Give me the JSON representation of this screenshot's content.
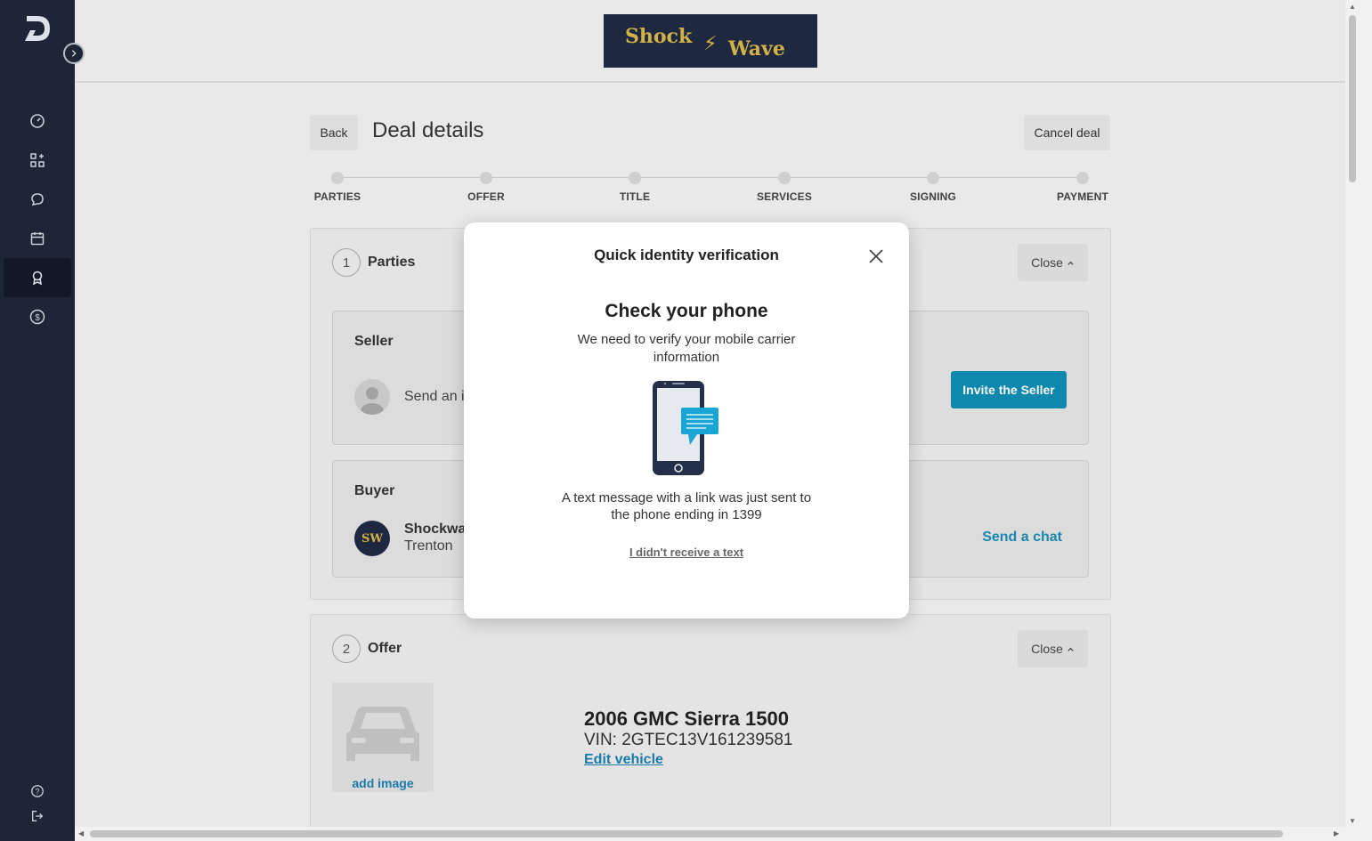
{
  "brand": {
    "logo_line1": "Shock",
    "logo_line2": "Wave",
    "bolt": "⚡"
  },
  "header": {
    "back_label": "Back",
    "title": "Deal details",
    "cancel_label": "Cancel deal"
  },
  "steps": [
    {
      "label": "PARTIES"
    },
    {
      "label": "OFFER"
    },
    {
      "label": "TITLE"
    },
    {
      "label": "SERVICES"
    },
    {
      "label": "SIGNING"
    },
    {
      "label": "PAYMENT"
    }
  ],
  "parties": {
    "number": "1",
    "title": "Parties",
    "close_label": "Close",
    "seller": {
      "title": "Seller",
      "text": "Send an in",
      "invite_label": "Invite the Seller"
    },
    "buyer": {
      "title": "Buyer",
      "name": "Shockway",
      "city": "Trenton",
      "chat_label": "Send a chat",
      "avatar_text": "SW"
    }
  },
  "offer": {
    "number": "2",
    "title": "Offer",
    "close_label": "Close",
    "add_image_label": "add image",
    "vehicle_name": "2006 GMC Sierra 1500",
    "vin": "VIN: 2GTEC13V161239581",
    "edit_label": "Edit vehicle"
  },
  "modal": {
    "title": "Quick identity verification",
    "heading": "Check your phone",
    "subtitle": "We need to verify your mobile carrier information",
    "message": "A text message with a link was just sent to the phone ending in 1399",
    "link_label": "I didn't receive a text"
  },
  "colors": {
    "sidebar": "#1d2536",
    "accent": "#0f8eb3",
    "link": "#1b7fb0",
    "brand_bg": "#1f2a44",
    "brand_text": "#d9b84a"
  },
  "icons": [
    "logo-icon",
    "expand-icon",
    "dashboard-icon",
    "apps-icon",
    "chat-icon",
    "calendar-icon",
    "award-icon",
    "dollar-icon",
    "help-icon",
    "logout-icon",
    "close-icon",
    "chevron-up-icon",
    "phone-icon"
  ]
}
